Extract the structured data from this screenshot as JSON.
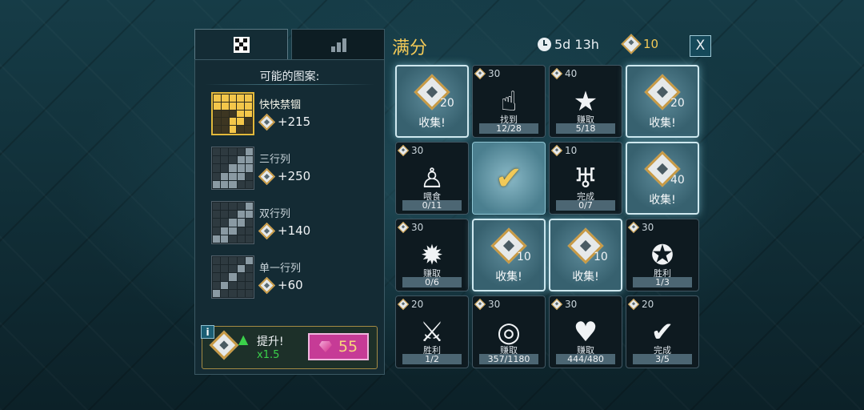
{
  "tabs": [
    {
      "icon": "checkerboard-icon"
    },
    {
      "icon": "bar-chart-icon"
    }
  ],
  "left_panel": {
    "title": "可能的图案:",
    "patterns": [
      {
        "name": "快快禁锢",
        "reward": "+215",
        "selected": true,
        "grid": [
          1,
          1,
          1,
          1,
          1,
          1,
          1,
          1,
          1,
          1,
          0,
          0,
          0,
          1,
          1,
          0,
          0,
          1,
          1,
          0,
          0,
          0,
          1,
          0,
          0
        ]
      },
      {
        "name": "三行列",
        "reward": "+250",
        "selected": false,
        "grid": [
          0,
          0,
          0,
          0,
          1,
          0,
          0,
          0,
          1,
          1,
          0,
          0,
          1,
          1,
          1,
          0,
          1,
          1,
          1,
          0,
          1,
          1,
          1,
          0,
          0
        ]
      },
      {
        "name": "双行列",
        "reward": "+140",
        "selected": false,
        "grid": [
          0,
          0,
          0,
          0,
          1,
          0,
          0,
          0,
          1,
          1,
          0,
          0,
          1,
          1,
          0,
          0,
          1,
          1,
          0,
          0,
          1,
          1,
          0,
          0,
          0
        ]
      },
      {
        "name": "单一行列",
        "reward": "+60",
        "selected": false,
        "grid": [
          0,
          0,
          0,
          0,
          1,
          0,
          0,
          0,
          1,
          0,
          0,
          0,
          1,
          0,
          0,
          0,
          1,
          0,
          0,
          0,
          1,
          0,
          0,
          0,
          0
        ]
      }
    ],
    "boost": {
      "info": "i",
      "label": "提升!",
      "multiplier": "x1.5",
      "gem_cost": "55"
    }
  },
  "header": {
    "title": "满分",
    "timer": "5d 13h",
    "tokens": "10",
    "close": "X"
  },
  "tiles": [
    {
      "type": "collect",
      "reward": "20",
      "label": "收集!"
    },
    {
      "type": "task",
      "cost": "30",
      "icon": "hand-point-icon",
      "art": "☝",
      "action": "找到",
      "progress": "12/28"
    },
    {
      "type": "task",
      "cost": "40",
      "icon": "star-shield-icon",
      "art": "★",
      "action": "赚取",
      "progress": "5/18"
    },
    {
      "type": "collect",
      "reward": "20",
      "label": "收集!"
    },
    {
      "type": "task",
      "cost": "30",
      "icon": "feed-figure-icon",
      "art": "♙",
      "action": "喂食",
      "progress": "0/11"
    },
    {
      "type": "done"
    },
    {
      "type": "task",
      "cost": "10",
      "icon": "chalice-icon",
      "art": "♅",
      "action": "完成",
      "progress": "0/7"
    },
    {
      "type": "collect",
      "reward": "40",
      "label": "收集!"
    },
    {
      "type": "task",
      "cost": "30",
      "icon": "burst-icon",
      "art": "✹",
      "action": "赚取",
      "progress": "0/6"
    },
    {
      "type": "collect",
      "reward": "10",
      "label": "收集!"
    },
    {
      "type": "collect",
      "reward": "10",
      "label": "收集!"
    },
    {
      "type": "task",
      "cost": "30",
      "icon": "ribbon-badge-icon",
      "art": "✪",
      "action": "胜利",
      "progress": "1/3"
    },
    {
      "type": "task",
      "cost": "20",
      "icon": "sword-shield-icon",
      "art": "⚔",
      "action": "胜利",
      "progress": "1/2"
    },
    {
      "type": "task",
      "cost": "30",
      "icon": "coins-icon",
      "art": "◎",
      "action": "赚取",
      "progress": "357/1180"
    },
    {
      "type": "task",
      "cost": "30",
      "icon": "heart-book-icon",
      "art": "♥",
      "action": "赚取",
      "progress": "444/480"
    },
    {
      "type": "task",
      "cost": "20",
      "icon": "check-loop-icon",
      "art": "✔",
      "action": "完成",
      "progress": "3/5"
    }
  ]
}
